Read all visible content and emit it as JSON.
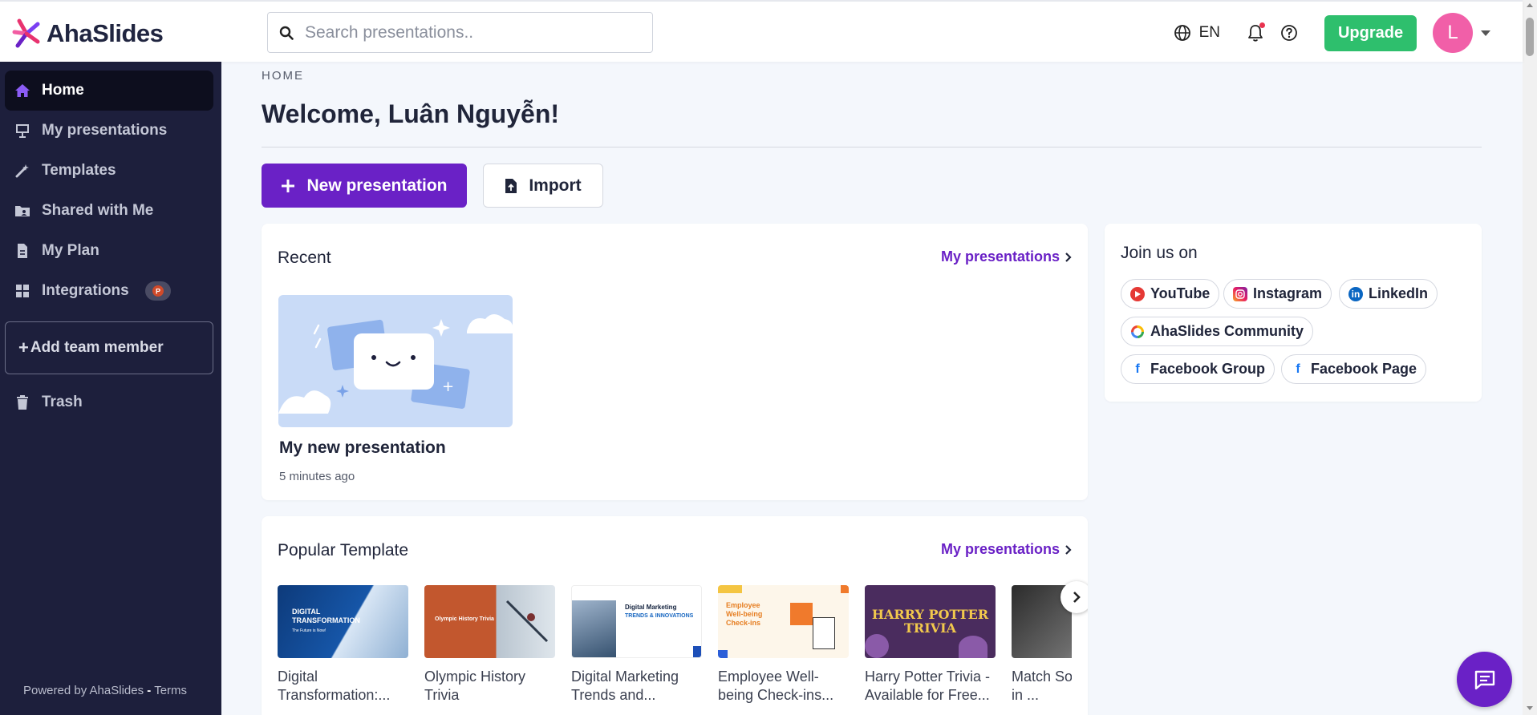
{
  "header": {
    "logo_text": "AhaSlides",
    "search_placeholder": "Search presentations..",
    "language": "EN",
    "upgrade_label": "Upgrade",
    "avatar_initial": "L"
  },
  "sidebar": {
    "items": [
      {
        "label": "Home",
        "icon": "home-icon",
        "active": true
      },
      {
        "label": "My presentations",
        "icon": "presentation-icon"
      },
      {
        "label": "Templates",
        "icon": "magic-wand-icon"
      },
      {
        "label": "Shared with Me",
        "icon": "shared-folder-icon"
      },
      {
        "label": "My Plan",
        "icon": "receipt-icon"
      },
      {
        "label": "Integrations",
        "icon": "grid-icon"
      },
      {
        "label": "Trash",
        "icon": "trash-icon"
      }
    ],
    "add_team_member": "Add team member",
    "powered_prefix": "Powered by AhaSlides",
    "powered_sep": "-",
    "terms": "Terms"
  },
  "main": {
    "breadcrumb": "HOME",
    "welcome": "Welcome, Luân Nguyễn!",
    "new_presentation": "New presentation",
    "import": "Import",
    "recent": {
      "title": "Recent",
      "link": "My presentations",
      "items": [
        {
          "name": "My new presentation",
          "time": "5 minutes ago"
        }
      ]
    },
    "join": {
      "title": "Join us on",
      "links": [
        {
          "label": "YouTube",
          "icon": "youtube-icon",
          "color": "#e53935"
        },
        {
          "label": "Instagram",
          "icon": "instagram-icon",
          "color": "#d6249f"
        },
        {
          "label": "LinkedIn",
          "icon": "linkedin-icon",
          "color": "#0a66c2"
        },
        {
          "label": "AhaSlides Community",
          "icon": "community-icon",
          "color": "#34a853"
        },
        {
          "label": "Facebook Group",
          "icon": "facebook-icon",
          "color": "#1877f2"
        },
        {
          "label": "Facebook Page",
          "icon": "facebook-icon",
          "color": "#1877f2"
        }
      ]
    },
    "popular": {
      "title": "Popular Template",
      "link": "My presentations",
      "templates": [
        {
          "name": "Digital Transformation:...",
          "thumb_title": "DIGITAL TRANSFORMATION",
          "thumb_sub": "The Future is Now!"
        },
        {
          "name": "Olympic History Trivia",
          "thumb_title": "Olympic History Trivia"
        },
        {
          "name": "Digital Marketing Trends and...",
          "thumb_title": "Digital Marketing",
          "thumb_title2": "TRENDS & INNOVATIONS"
        },
        {
          "name": "Employee Well-being Check-ins...",
          "thumb_title": "Employee Well-being Check-ins"
        },
        {
          "name": "Harry Potter Trivia - Available for Free...",
          "thumb_title": "HARRY POTTER TRIVIA"
        },
        {
          "name": "Match Song Singer in ..."
        }
      ]
    }
  }
}
